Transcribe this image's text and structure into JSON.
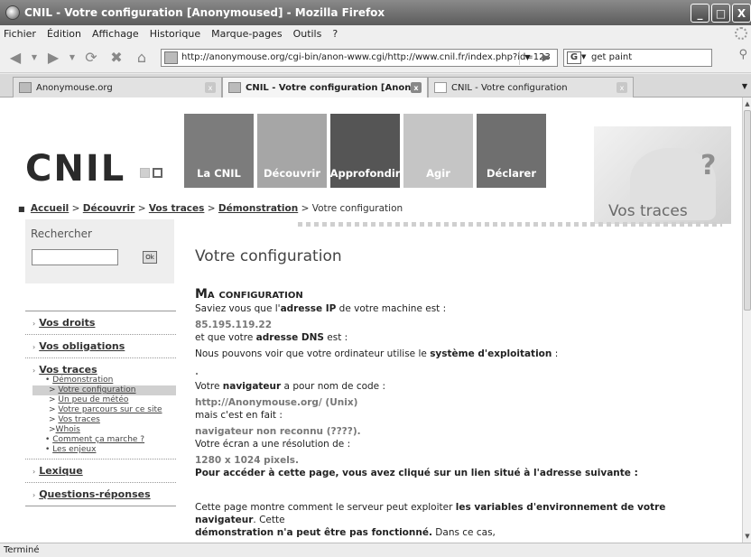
{
  "window": {
    "title": "CNIL - Votre configuration [Anonymoused] - Mozilla Firefox",
    "btn_min": "_",
    "btn_max": "□",
    "btn_close": "X"
  },
  "menu": [
    "Fichier",
    "Édition",
    "Affichage",
    "Historique",
    "Marque-pages",
    "Outils",
    "?"
  ],
  "nav": {
    "url": "http://anonymouse.org/cgi-bin/anon-www.cgi/http://www.cnil.fr/index.php?id=123",
    "search_value": "get paint",
    "search_engine": "G"
  },
  "tabs": [
    {
      "label": "Anonymouse.org",
      "active": false
    },
    {
      "label": "CNIL - Votre configuration [Anon...",
      "active": true
    },
    {
      "label": "CNIL - Votre configuration",
      "active": false
    }
  ],
  "site": {
    "logo": "CNIL",
    "topnav": [
      "La CNIL",
      "Découvrir",
      "Approfondir",
      "Agir",
      "Déclarer"
    ],
    "vt_label": "Vos traces",
    "breadcrumb": {
      "bullet": "■",
      "items": [
        "Accueil",
        "Découvrir",
        "Vos traces",
        "Démonstration"
      ],
      "sep": ">",
      "current": "Votre configuration"
    },
    "search": {
      "label": "Rechercher",
      "button": "Ok"
    },
    "page_title": "Votre configuration",
    "leftnav": [
      {
        "label": "Vos droits"
      },
      {
        "label": "Vos obligations"
      },
      {
        "label": "Vos traces",
        "sub": [
          {
            "prefix": "•",
            "label": "Démonstration"
          },
          {
            "prefix": ">",
            "label": "Votre configuration",
            "highlight": true
          },
          {
            "prefix": ">",
            "label": "Un peu de météo"
          },
          {
            "prefix": ">",
            "label": "Votre parcours sur ce site"
          },
          {
            "prefix": ">",
            "label": "Vos traces"
          },
          {
            "prefix": ">",
            "label": "Whois"
          },
          {
            "prefix": "•",
            "label": "Comment ça marche ?"
          },
          {
            "prefix": "•",
            "label": "Les enjeux"
          }
        ]
      },
      {
        "label": "Lexique"
      },
      {
        "label": "Questions-réponses"
      }
    ],
    "main": {
      "heading": "Ma configuration",
      "l1a": "Saviez vous que l'",
      "l1b": "adresse IP",
      "l1c": " de votre machine est :",
      "ip": "85.195.119.22",
      "l2a": "et que votre ",
      "l2b": "adresse DNS",
      "l2c": " est :",
      "l3a": "Nous pouvons voir que votre ordinateur utilise le ",
      "l3b": "système d'exploitation",
      "l3c": " :",
      "os": ".",
      "l4a": "Votre ",
      "l4b": "navigateur",
      "l4c": " a pour nom de code :",
      "ua": "http://Anonymouse.org/ (Unix)",
      "l5": "mais c'est en fait :",
      "browser": "navigateur non reconnu (????).",
      "l6": "Votre écran a une résolution de :",
      "resolution": "1280 x 1024 pixels.",
      "l7": "Pour accéder à cette page, vous avez cliqué sur un lien situé à l'adresse suivante :",
      "l8a": "Cette page montre comment le serveur peut exploiter ",
      "l8b": "les variables d'environnement de votre navigateur",
      "l8c": ". Cette",
      "l9a": "démonstration n'a peut être pas fonctionné.",
      "l9b": " Dans ce cas,"
    }
  },
  "status": "Terminé"
}
